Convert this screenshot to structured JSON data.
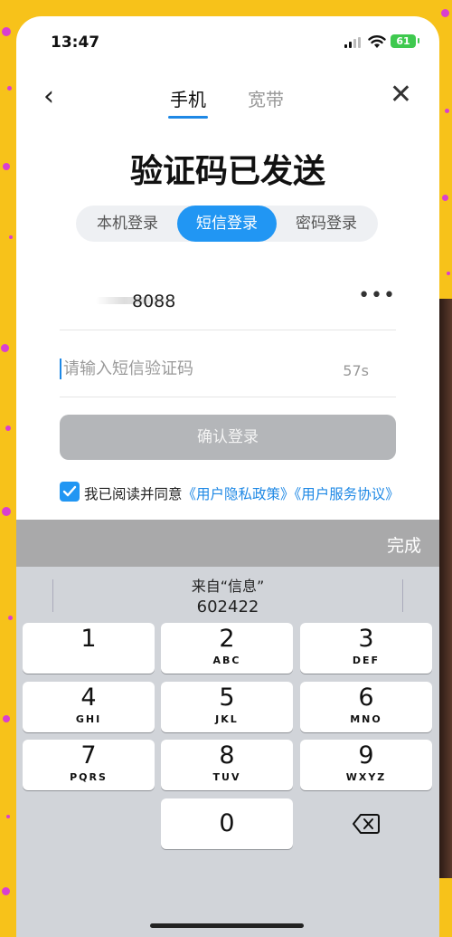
{
  "status": {
    "time": "13:47",
    "battery": "61"
  },
  "nav": {
    "back": "‹",
    "tab_phone": "手机",
    "tab_broadband": "宽带",
    "close": "✕"
  },
  "title": "验证码已发送",
  "segments": {
    "local": "本机登录",
    "sms": "短信登录",
    "password": "密码登录",
    "selected": "短信登录"
  },
  "phone_field": {
    "value": "8088",
    "more": "•••"
  },
  "code_field": {
    "placeholder": "请输入短信验证码",
    "value": "",
    "countdown": "57s"
  },
  "login_button": "确认登录",
  "agreement": {
    "prefix": "我已阅读并同意",
    "privacy": "《用户隐私政策》",
    "service": "《用户服务协议》",
    "checked": true
  },
  "keyboard": {
    "done": "完成",
    "suggestion_from": "来自“信息”",
    "suggestion_code": "602422",
    "keys": [
      {
        "digit": "1",
        "letters": ""
      },
      {
        "digit": "2",
        "letters": "ABC"
      },
      {
        "digit": "3",
        "letters": "DEF"
      },
      {
        "digit": "4",
        "letters": "GHI"
      },
      {
        "digit": "5",
        "letters": "JKL"
      },
      {
        "digit": "6",
        "letters": "MNO"
      },
      {
        "digit": "7",
        "letters": "PQRS"
      },
      {
        "digit": "8",
        "letters": "TUV"
      },
      {
        "digit": "9",
        "letters": "WXYZ"
      },
      {
        "digit": "0",
        "letters": ""
      }
    ]
  },
  "colors": {
    "accent": "#2196f3",
    "background": "#f7c21a",
    "dots": "#d93fd0",
    "disabled_button": "#b4b6b9"
  }
}
